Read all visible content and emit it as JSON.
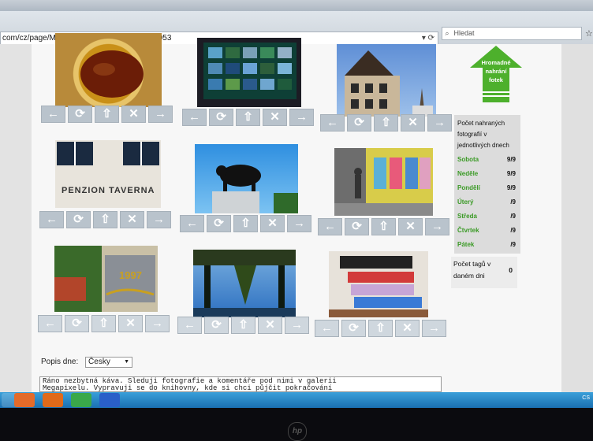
{
  "browser": {
    "url": "com/cz/page/MyWeek.aspx?w=14362&g=99953",
    "search_placeholder": "Hledat"
  },
  "upload": {
    "label": "Hromadné nahrání fotek"
  },
  "stats": {
    "title": "Počet nahraných fotografií v jednotlivých dnech",
    "days": [
      {
        "day": "Sobota",
        "value": "9/9"
      },
      {
        "day": "Neděle",
        "value": "9/9"
      },
      {
        "day": "Pondělí",
        "value": "9/9"
      },
      {
        "day": "Úterý",
        "value": "/9"
      },
      {
        "day": "Středa",
        "value": "/9"
      },
      {
        "day": "Čtvrtek",
        "value": "/9"
      },
      {
        "day": "Pátek",
        "value": "/9"
      }
    ]
  },
  "tags": {
    "label": "Počet tagů v daném dni",
    "value": "0"
  },
  "photos": [
    {
      "name": "tea",
      "overlay": ""
    },
    {
      "name": "monitor",
      "overlay": ""
    },
    {
      "name": "house",
      "overlay": ""
    },
    {
      "name": "penzion",
      "overlay": "PENZION TAVERNA"
    },
    {
      "name": "bull-statue",
      "overlay": ""
    },
    {
      "name": "street",
      "overlay": ""
    },
    {
      "name": "plaque",
      "overlay": "1997"
    },
    {
      "name": "reflection",
      "overlay": ""
    },
    {
      "name": "books",
      "overlay": ""
    }
  ],
  "controls": {
    "left": "←",
    "rotate": "⟳",
    "up": "⇧",
    "delete": "✕",
    "right": "→"
  },
  "description": {
    "label": "Popis dne:",
    "language": "Česky",
    "text_line1": "Ráno nezbytná káva. Sleduji fotografie  a komentáře pod nimi v galerii",
    "text_line2": "Megapixelu. Vypravuji se  do knihovny, kde si chci půjčit pokračování"
  },
  "taskbar": {
    "tray_lang": "CS"
  },
  "brand": "hp"
}
